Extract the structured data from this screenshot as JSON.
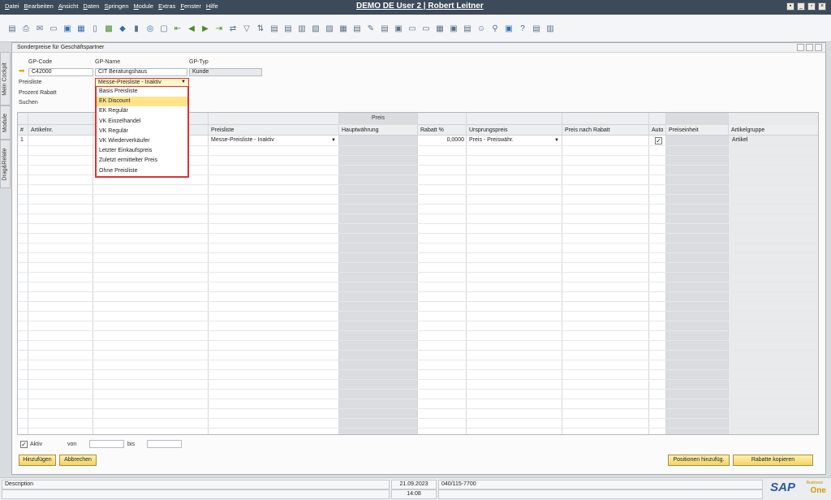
{
  "menu": [
    "Datei",
    "Bearbeiten",
    "Ansicht",
    "Daten",
    "Springen",
    "Module",
    "Extras",
    "Fenster",
    "Hilfe"
  ],
  "app_title": "DEMO DE User 2 | Robert Leitner",
  "side_tabs": [
    "Mein Cockpit",
    "Module",
    "Drag&Relate"
  ],
  "window": {
    "title": "Sonderpreise für Geschäftspartner",
    "gp_code_label": "GP-Code",
    "gp_name_label": "GP-Name",
    "gp_type_label": "GP-Typ",
    "gp_code_value": "C42000",
    "gp_name_value": "CIT Beratungshaus",
    "gp_type_value": "Kunde",
    "preisliste_label": "Preisliste",
    "prozent_rabatt_label": "Prozent Rabatt",
    "suchen_label": "Suchen",
    "preisliste_selected": "Messe-Preisliste - Inaktiv",
    "preisliste_options": [
      "Basis Preisliste",
      "EK Discount",
      "EK Regulär",
      "VK Einzelhandel",
      "VK Regulär",
      "VK Wiederverkäufer",
      "Letzter Einkaufspreis",
      "Zuletzt ermittelter Preis",
      "Ohne Preisliste"
    ],
    "preisliste_highlighted": "EK Discount"
  },
  "grid": {
    "group_header": "Preis",
    "columns": [
      "#",
      "Artikelnr.",
      "",
      "Preisliste",
      "Hauptwährung",
      "Rabatt %",
      "Ursprungspreis",
      "Preis nach Rabatt",
      "Auto",
      "Preiseinheit",
      "Artikelgruppe"
    ],
    "rows": [
      {
        "num": "1",
        "preisliste": "Messe-Preisliste - Inaktiv",
        "rabatt": "0,0000",
        "ursprungspreis": "Preis - Preiswähr.",
        "auto": "✓",
        "artikelgruppe": "Artikel"
      }
    ]
  },
  "footer": {
    "aktiv_label": "Aktiv",
    "aktiv_checked": "✓",
    "von_label": "von",
    "bis_label": "bis",
    "add_button": "Hinzufügen",
    "cancel_button": "Abbrechen",
    "add_positions_button": "Positionen hinzufüg.",
    "copy_discounts_button": "Rabatte kopieren"
  },
  "status": {
    "description": "Description",
    "date": "21.09.2023",
    "time": "14:08",
    "phone": "040/115-7700"
  },
  "logo": {
    "sap": "SAP",
    "business": "Business",
    "one": "One"
  },
  "colors": {
    "accent": "#f7d262",
    "highlight_border": "#d33",
    "title_bar": "#3c4a5a"
  }
}
